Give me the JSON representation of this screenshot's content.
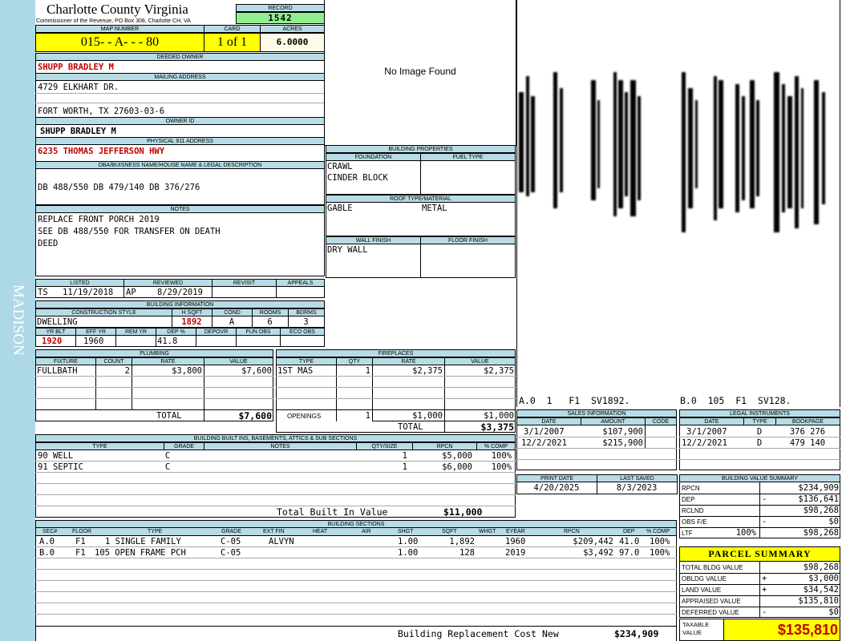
{
  "side_label": "MADISON",
  "county": {
    "title": "Charlotte County Virginia",
    "sub": "Commissioner of the Revenue, PO Box 308, Charlotte CH, VA"
  },
  "record": {
    "label": "RECORD",
    "value": "1542"
  },
  "map": {
    "label": "MAP NUMBER",
    "value": "015- - A- - - 80"
  },
  "card": {
    "label": "CARD",
    "value": "1 of 1"
  },
  "acres": {
    "label": "ACRES",
    "value": "6.0000"
  },
  "image_text": "No Image Found",
  "owner": {
    "deeded_label": "DEEDED OWNER",
    "deeded": "SHUPP BRADLEY M",
    "mailing_label": "MAILING ADDRESS",
    "addr1": "4729 ELKHART DR.",
    "addr2": "FORT WORTH, TX 27603-03-6",
    "owner_id_label": "OWNER ID",
    "owner_id": "SHUPP BRADLEY M",
    "phys_label": "PHYSICAL 911 ADDRESS",
    "phys": "6235 THOMAS JEFFERSON HWY"
  },
  "legal": {
    "label": "DBA/BUISNESS NAME/HOUSE NAME & LEGAL DESCRIPTION",
    "text": "DB 488/550 DB 479/140 DB 376/276"
  },
  "notes": {
    "label": "NOTES",
    "lines": [
      "REPLACE FRONT PORCH 2019",
      "SEE DB 488/550 FOR TRANSFER ON DEATH",
      "DEED"
    ]
  },
  "props": {
    "label": "BUILDING PROPERTIES",
    "foundation_label": "FOUNDATION",
    "fuel_label": "FUEL TYPE",
    "foundation": [
      "CRAWL",
      "CINDER BLOCK"
    ],
    "roof_label": "ROOF TYPE/MATERIAL",
    "roof_type": "GABLE",
    "roof_mat": "METAL",
    "wall_label": "WALL FINISH",
    "floor_label": "FLOOR FINISH",
    "wall": "DRY WALL"
  },
  "listed": {
    "listed_label": "LISTED",
    "reviewed_label": "REVIEWED",
    "revisit_label": "REVISIT",
    "appeals_label": "APPEALS",
    "listed_by": "TS",
    "listed_date": "11/19/2018",
    "rev_by": "AP",
    "rev_date": "8/29/2019"
  },
  "bldg_info": {
    "label": "BUILDING INFORMATION",
    "style_label": "CONSTRUCTION STYLE",
    "hsqft_label": "H SQFT",
    "cond_label": "COND",
    "rooms_label": "ROOMS",
    "bdrms_label": "BDRMS",
    "style": "DWELLING",
    "hsqft": "1892",
    "cond": "A",
    "rooms": "6",
    "bdrms": "3",
    "yrblt_label": "YR BLT",
    "effyr_label": "EFF YR",
    "remyr_label": "REM YR",
    "dep_label": "DEP %",
    "depovr_label": "DEPOVR",
    "funobs_label": "FUN OBS",
    "ecoobs_label": "ECO OBS",
    "yrblt": "1920",
    "effyr": "1960",
    "dep": "41.8"
  },
  "sketch_labels": [
    "A.0  1   F1  SV1892.",
    "B.0  105  F1  SV128."
  ],
  "plumbing": {
    "label": "PLUMBING",
    "cols": [
      "FIXTURE",
      "COUNT",
      "RATE",
      "VALUE"
    ],
    "rows": [
      [
        "FULLBATH",
        "2",
        "$3,800",
        "$7,600"
      ]
    ],
    "total_label": "TOTAL",
    "total": "$7,600"
  },
  "fireplaces": {
    "label": "FIREPLACES",
    "cols": [
      "TYPE",
      "QTY",
      "RATE",
      "VALUE"
    ],
    "rows": [
      [
        "1ST MAS",
        "1",
        "$2,375",
        "$2,375"
      ]
    ],
    "openings_label": "OPENINGS",
    "openings": [
      "1",
      "$1,000",
      "$1,000"
    ],
    "total_label": "TOTAL",
    "total": "$3,375"
  },
  "sales": {
    "label": "SALES INFORMATION",
    "cols": [
      "DATE",
      "AMOUNT",
      "CODE"
    ],
    "rows": [
      [
        "3/1/2007",
        "$107,900",
        ""
      ],
      [
        "12/2/2021",
        "$215,900",
        ""
      ]
    ]
  },
  "legal_inst": {
    "label": "LEGAL INSTRUMENTS",
    "cols": [
      "DATE",
      "TYPE",
      "BOOKPAGE"
    ],
    "rows": [
      [
        "3/1/2007",
        "D",
        "376 276"
      ],
      [
        "12/2/2021",
        "D",
        "479 140"
      ]
    ]
  },
  "builtins": {
    "label": "BUILDING BUILT INS, BASEMENTS, ATTICS & SUB SECTIONS",
    "cols": [
      "TYPE",
      "GRADE",
      "NOTES",
      "QTY/SIZE",
      "RPCN",
      "% COMP"
    ],
    "rows": [
      [
        "90 WELL",
        "C",
        "",
        "1",
        "$5,000",
        "100%"
      ],
      [
        "91 SEPTIC",
        "C",
        "",
        "1",
        "$6,000",
        "100%"
      ]
    ],
    "total_label": "Total Built In Value",
    "total": "$11,000"
  },
  "print": {
    "print_label": "PRINT DATE",
    "saved_label": "LAST SAVED",
    "print_date": "4/20/2025",
    "last_saved": "8/3/2023"
  },
  "bvs": {
    "label": "BUILDING VALUE SUMMARY",
    "rows": [
      {
        "l": "RPCN",
        "s": "",
        "v": "$234,909"
      },
      {
        "l": "DEP",
        "s": "-",
        "v": "$136,641"
      },
      {
        "l": "RCLND",
        "s": "",
        "v": "$98,268"
      },
      {
        "l": "OBS F/E",
        "s": "-",
        "v": "$0"
      },
      {
        "l": "LTF",
        "p": "100%",
        "s": "",
        "v": "$98,268"
      }
    ]
  },
  "sections": {
    "label": "BUILDING SECTIONS",
    "cols": [
      "SEC#",
      "FLOOR",
      "TYPE",
      "GRADE",
      "EXT FIN",
      "HEAT",
      "AIR",
      "SHGT",
      "SQFT",
      "WHGT",
      "EYEAR",
      "RPCN",
      "DEP",
      "% COMP"
    ],
    "rows": [
      [
        "A.0",
        "F1",
        "1 SINGLE FAMILY",
        "C-05",
        "ALVYN",
        "",
        "",
        "1.00",
        "1,892",
        "",
        "1960",
        "$209,442",
        "41.0",
        "100%"
      ],
      [
        "B.0",
        "F1",
        "105 OPEN FRAME PCH",
        "C-05",
        "",
        "",
        "",
        "1.00",
        "128",
        "",
        "2019",
        "$3,492",
        "97.0",
        "100%"
      ]
    ],
    "total_label": "Building Replacement Cost New",
    "total": "$234,909"
  },
  "parcel": {
    "label": "PARCEL SUMMARY",
    "rows": [
      {
        "l": "TOTAL BLDG VALUE",
        "s": "",
        "v": "$98,268"
      },
      {
        "l": "OBLDG VALUE",
        "s": "+",
        "v": "$3,000"
      },
      {
        "l": "LAND VALUE",
        "s": "+",
        "v": "$34,542"
      },
      {
        "l": "APPRAISED VALUE",
        "s": "",
        "v": "$135,810"
      },
      {
        "l": "DEFERRED VALUE",
        "s": "-",
        "v": "$0"
      }
    ],
    "taxable_label": "TAXABLE VALUE",
    "taxable": "$135,810"
  },
  "colors": {
    "header": "#b8dce6",
    "highlight": "#ffff00",
    "side": "#add8e6",
    "red": "#c00000",
    "record_green": "#90ee90"
  }
}
